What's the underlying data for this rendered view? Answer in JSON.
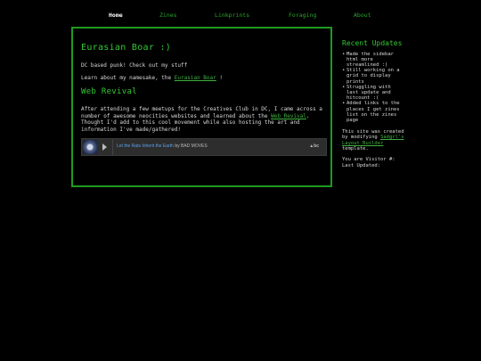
{
  "nav": {
    "items": [
      "Home",
      "Zines",
      "Linkprints",
      "Foraging",
      "About"
    ]
  },
  "main": {
    "title": "Eurasian Boar :)",
    "intro": "DC based punk! Check out my stuff",
    "learn_prefix": "Learn about my namesake, the",
    "learn_link": "Eurasian Boar",
    "learn_suffix": "!",
    "section_title": "Web Revival",
    "revival_text_1": "After attending a few meetups for the Creatives Club in DC, I came across a number of awesome neocities websites and learned about the",
    "revival_link": "Web Revival",
    "revival_text_2": ". Thought I'd add to this cool movement while also hosting the art and information I've made/gathered!"
  },
  "player": {
    "song": "Let the Rats Inherit the Earth",
    "by": "by",
    "artist": "BAD MOVES",
    "logo": "bc"
  },
  "sidebar": {
    "title": "Recent Updates",
    "items": [
      "Made the sidebar html more streamlined :)",
      "Still working on a grid to display prints",
      "Struggling with last update and hitcount :(",
      "Added links to the places I get zines list on the zines page"
    ],
    "credit_prefix": "This site was created by modifying",
    "credit_link": "Sadgrl's Layout Builder",
    "credit_suffix": "template.",
    "visitor_text": "You are Visitor #:",
    "last_updated": "Last Updated:"
  },
  "colors": {
    "accent": "#33c833",
    "border": "#1f9a1f",
    "background": "#000000",
    "text": "#d8d8d8"
  }
}
